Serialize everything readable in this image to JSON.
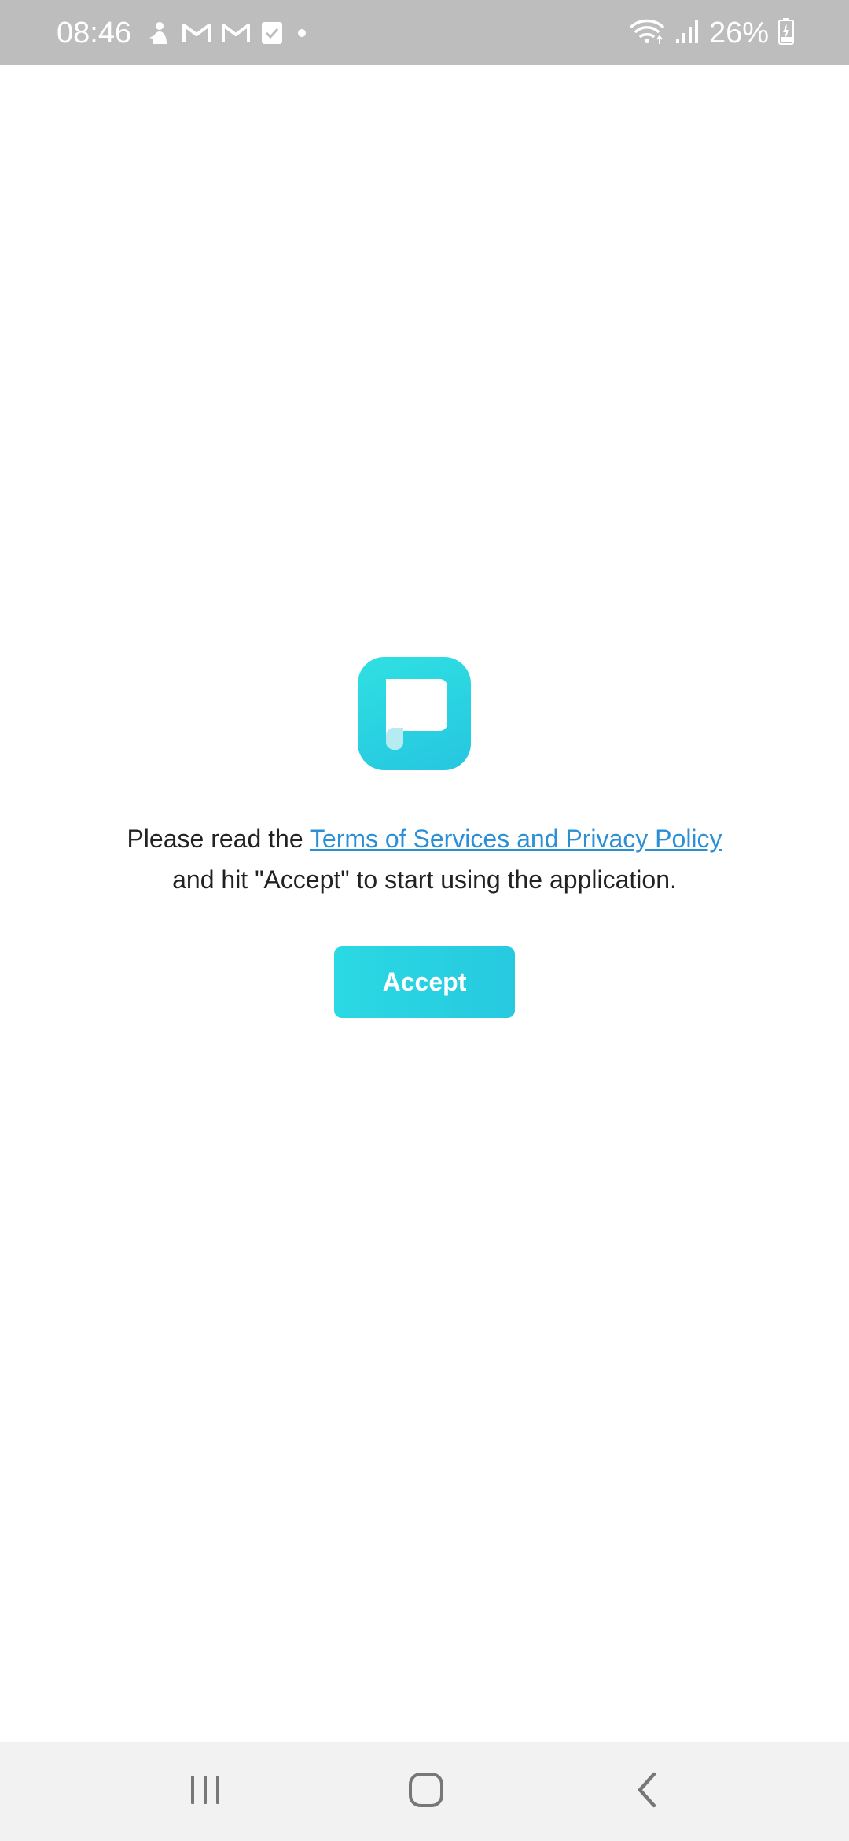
{
  "status_bar": {
    "time": "08:46",
    "battery_percent": "26%",
    "left_icons": [
      "person-notification-icon",
      "gmail-icon",
      "gmail-icon",
      "task-check-icon",
      "dot-icon"
    ],
    "right_icons": [
      "wifi-icon",
      "signal-icon",
      "battery-charging-icon"
    ]
  },
  "app": {
    "logo_icon": "app-logo-icon",
    "accent_color": "#27cfe1",
    "link_color": "#2b8fd6"
  },
  "terms": {
    "prefix": "Please read the ",
    "link_text": "Terms of Services and Privacy Policy",
    "second_line": "and hit \"Accept\" to start using the application."
  },
  "accept_button": {
    "label": "Accept"
  },
  "nav_bar": {
    "recents_icon": "recents-icon",
    "home_icon": "home-icon",
    "back_icon": "back-icon"
  }
}
